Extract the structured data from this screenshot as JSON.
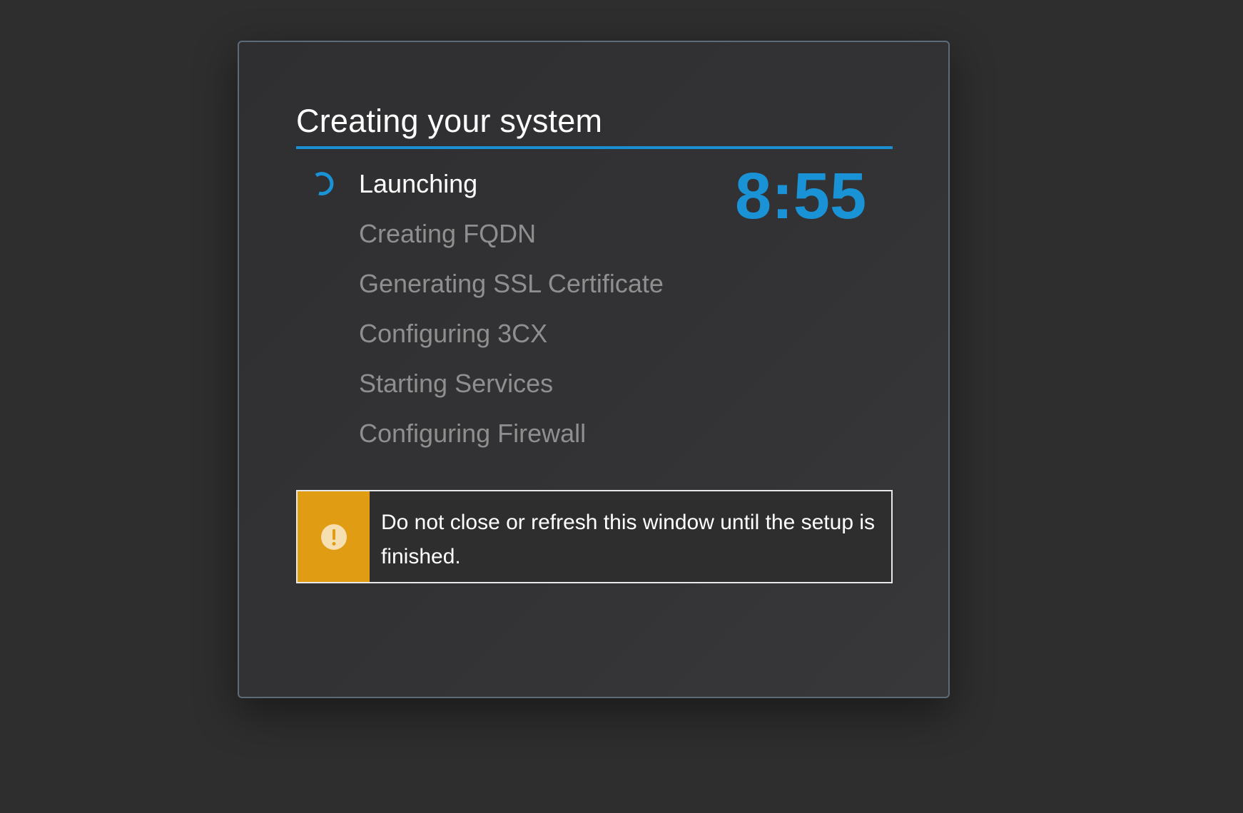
{
  "dialog": {
    "title": "Creating your system",
    "timer": "8:55",
    "steps": [
      {
        "label": "Launching",
        "state": "active"
      },
      {
        "label": "Creating FQDN",
        "state": "pending"
      },
      {
        "label": "Generating SSL Certificate",
        "state": "pending"
      },
      {
        "label": "Configuring 3CX",
        "state": "pending"
      },
      {
        "label": "Starting Services",
        "state": "pending"
      },
      {
        "label": "Configuring Firewall",
        "state": "pending"
      }
    ],
    "alert": {
      "icon": "exclamation-circle-icon",
      "message": "Do not close or refresh this window until the setup is finished."
    }
  },
  "colors": {
    "accent": "#1a93d6",
    "warning": "#e09c12",
    "active_text": "#ffffff",
    "pending_text": "#8f8f8f"
  }
}
